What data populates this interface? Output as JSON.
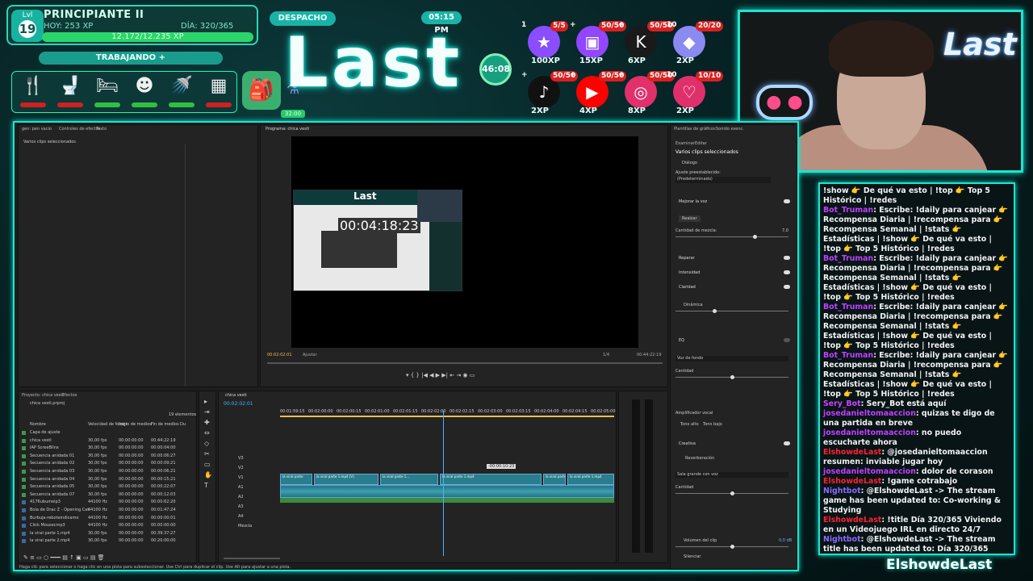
{
  "overlay": {
    "level_badge_label": "Lvl",
    "level_number": "19",
    "level_title": "PRINCIPIANTE II",
    "today_xp": "HOY: 253 XP",
    "day_counter": "DÍA: 320/365",
    "xp_progress": "12.172/12.235 XP",
    "status": "TRABAJANDO",
    "status_plus": "+",
    "dispatch": "DESPACHO",
    "clock": "05:15 PM",
    "logo": "Last",
    "timer": "46:08",
    "potion_value": "32:00",
    "needs": [
      {
        "icon": "utensils-icon",
        "glyph": "🍴",
        "level": "low"
      },
      {
        "icon": "toilet-icon",
        "glyph": "🚽",
        "level": "low"
      },
      {
        "icon": "bed-icon",
        "glyph": "🛏",
        "level": "mid"
      },
      {
        "icon": "social-icon",
        "glyph": "☻",
        "level": "mid"
      },
      {
        "icon": "shower-icon",
        "glyph": "🚿",
        "level": "mid"
      },
      {
        "icon": "fun-icon",
        "glyph": "▦",
        "level": "low"
      }
    ],
    "goals": [
      {
        "icon": "star-icon",
        "glyph": "★",
        "color": "#8a4dff",
        "count": "5/5",
        "num": "1",
        "xp": "100XP"
      },
      {
        "icon": "twitch-icon",
        "glyph": "▣",
        "color": "#9146ff",
        "count": "50/50",
        "num": "+",
        "xp": "15XP"
      },
      {
        "icon": "kick-icon",
        "glyph": "K",
        "color": "#1a1a1a",
        "count": "50/50",
        "num": "+",
        "xp": "6XP"
      },
      {
        "icon": "gem-icon",
        "glyph": "◆",
        "color": "#8a8af0",
        "count": "20/20",
        "num": "10",
        "xp": "2XP"
      },
      {
        "icon": "tiktok-icon",
        "glyph": "♪",
        "color": "#111111",
        "count": "50/50",
        "num": "+",
        "xp": "2XP"
      },
      {
        "icon": "youtube-icon",
        "glyph": "▶",
        "color": "#ff0000",
        "count": "50/50",
        "num": "+",
        "xp": "4XP"
      },
      {
        "icon": "instagram-icon",
        "glyph": "◎",
        "color": "#e1306c",
        "count": "50/50",
        "num": "+",
        "xp": "8XP"
      },
      {
        "icon": "heart-icon",
        "glyph": "♡",
        "color": "#e0306c",
        "count": "10/10",
        "num": "10",
        "xp": "2XP"
      }
    ],
    "channel_name": "ElshowdeLast",
    "webcam_logo": "Last"
  },
  "chat": [
    {
      "user": "",
      "color": "#ffffff",
      "text": "!show 👉 De qué va esto | !top 👉 Top 5 Histórico | !redes"
    },
    {
      "user": "Bot_Truman",
      "color": "#c040ff",
      "text": "Escribe: !daily para canjear 👉 Recompensa Diaria | !recompensa para 👉 Recompensa Semanal | !stats 👉 Estadísticas | !show 👉 De qué va esto | !top 👉 Top 5 Histórico | !redes"
    },
    {
      "user": "Bot_Truman",
      "color": "#c040ff",
      "text": "Escribe: !daily para canjear 👉 Recompensa Diaria | !recompensa para 👉 Recompensa Semanal | !stats 👉 Estadísticas | !show 👉 De qué va esto | !top 👉 Top 5 Histórico | !redes"
    },
    {
      "user": "Bot_Truman",
      "color": "#c040ff",
      "text": "Escribe: !daily para canjear 👉 Recompensa Diaria | !recompensa para 👉 Recompensa Semanal | !stats 👉 Estadísticas | !show 👉 De qué va esto | !top 👉 Top 5 Histórico | !redes"
    },
    {
      "user": "Bot_Truman",
      "color": "#c040ff",
      "text": "Escribe: !daily para canjear 👉 Recompensa Diaria | !recompensa para 👉 Recompensa Semanal | !stats 👉 Estadísticas | !show 👉 De qué va esto | !top 👉 Top 5 Histórico | !redes"
    },
    {
      "user": "Sery_Bot",
      "color": "#d040ff",
      "text": "Sery_Bot está aquí"
    },
    {
      "user": "josedanieltomaaccion",
      "color": "#c040ff",
      "text": "quizas te digo de una partida en breve"
    },
    {
      "user": "josedanieltomaaccion",
      "color": "#c040ff",
      "text": "no puedo escucharte ahora"
    },
    {
      "user": "ElshowdeLast",
      "color": "#ff2030",
      "text": "@josedanieltomaaccion resumen: inviable jugar hoy"
    },
    {
      "user": "josedanieltomaaccion",
      "color": "#c040ff",
      "text": "dolor de corason"
    },
    {
      "user": "ElshowdeLast",
      "color": "#ff2030",
      "text": "!game cotrabajo"
    },
    {
      "user": "Nightbot",
      "color": "#8a6aff",
      "text": "@ElshowdeLast -> The stream game has been updated to: Co-working & Studying"
    },
    {
      "user": "ElshowdeLast",
      "color": "#ff2030",
      "text": "!title Día 320/365 Viviendo en un Videojuego IRL en directo 24/7"
    },
    {
      "user": "Nightbot",
      "color": "#8a6aff",
      "text": "@ElshowdeLast -> The stream title has been updated to: Día 320/365 Viviendo en un Videojuego IRL en directo 24/7"
    }
  ],
  "premiere": {
    "source_tabs": [
      "gen: pen vacio",
      "Controles de efectos",
      "Texto"
    ],
    "source_empty": "Varios clips seleccionados",
    "program_tab": "Programa: chica vesti",
    "program_timestamp": "00:04:18:23",
    "program_tc_left": "00:02:02:01",
    "program_fit": "Ajustar",
    "program_quality": "1/4",
    "program_tc_right": "00:44:22:19",
    "project_tabs": [
      "Proyecto: chica vesti",
      "Efectos"
    ],
    "project_file": "chica vesti.prproj",
    "project_count": "19 elementos",
    "project_columns": [
      "Nombre",
      "Velocidad de fotogr.",
      "Inicio de medios",
      "Fin de medios",
      "Du"
    ],
    "project_items": [
      {
        "name": "Capa de ajuste",
        "rate": "",
        "start": "",
        "end": ""
      },
      {
        "name": "chica vesti",
        "rate": "30,00 fps",
        "start": "00:00:00:00",
        "end": "00:44:22:19"
      },
      {
        "name": "IAP ScreeBlinx",
        "rate": "30,00 fps",
        "start": "00:00:00:00",
        "end": "00:00:04:00"
      },
      {
        "name": "Secuencia anidada 01",
        "rate": "30,00 fps",
        "start": "00:00:00:00",
        "end": "00:00:06:27"
      },
      {
        "name": "Secuencia anidada 02",
        "rate": "30,00 fps",
        "start": "00:00:00:00",
        "end": "00:00:09:21"
      },
      {
        "name": "Secuencia anidada 03",
        "rate": "30,00 fps",
        "start": "00:00:00:00",
        "end": "00:00:06:21"
      },
      {
        "name": "Secuencia anidada 04",
        "rate": "30,00 fps",
        "start": "00:00:00:00",
        "end": "00:00:15:21"
      },
      {
        "name": "Secuencia anidada 05",
        "rate": "30,00 fps",
        "start": "00:00:00:00",
        "end": "00:00:22:07"
      },
      {
        "name": "Secuencia anidada 07",
        "rate": "30,00 fps",
        "start": "00:00:00:00",
        "end": "00:00:12:03"
      },
      {
        "name": "4176ubumeip3",
        "rate": "44100 Hz",
        "start": "00:00:00:00",
        "end": "00:00:62:20"
      },
      {
        "name": "Bola de Drac Z - Opening Cat",
        "rate": "44100 Hz",
        "start": "00:00:00:00",
        "end": "00:01:47:24"
      },
      {
        "name": "Burbuja-reboteindicamo",
        "rate": "44100 Hz",
        "start": "00:00:00:00",
        "end": "00:00:00:01"
      },
      {
        "name": "Click Mousecmp3",
        "rate": "44100 Hz",
        "start": "00:00:00:00",
        "end": "00:00:00:00"
      },
      {
        "name": "la viral parte 1.mp4",
        "rate": "30,00 fps",
        "start": "00:00:00:00",
        "end": "00:39:37:27"
      },
      {
        "name": "la viral parte 2.mp4",
        "rate": "30,00 fps",
        "start": "00:00:00:00",
        "end": "00:20:00:00"
      }
    ],
    "timeline_tab": "chica vesti",
    "timeline_tc": "00:02:02:01",
    "ruler": [
      "00:01:59:15",
      "00:02:00:00",
      "00:02:00:15",
      "00:02:01:00",
      "00:02:01:15",
      "00:02:02:00",
      "00:02:02:15",
      "00:02:03:00",
      "00:02:03:15",
      "00:02:04:00",
      "00:02:04:15",
      "00:02:05:00"
    ],
    "track_labels": [
      "V3",
      "V2",
      "V1",
      "A1",
      "A2",
      "A3",
      "A4",
      "Mezcla"
    ],
    "clips": [
      "la viral parte",
      "la viral parte 1.mp4 [V]",
      "la viral parte 1...",
      "la viral parte 1.mp4",
      "la viral parte 1.",
      "la viral parte 1.mp4"
    ],
    "playhead_tip": "-00:00:10:23",
    "status_bar": "Haga clic para seleccionar o haga clic en una pista para subsoleccionar. Use Ctrl para duplicar el clip. Use Alt para ajustar a una pista.",
    "right_tabs": [
      "Plantillas de gráficos",
      "Sonido esenc."
    ],
    "right_subtabs": [
      "Examinar",
      "Editar"
    ],
    "right_heading": "Varios clips seleccionados",
    "right_type": "Diálogo",
    "preset_label": "Ajuste preestablecido:",
    "preset_value": "(Predeterminado)",
    "sections": [
      {
        "label": "Mejorar la voz",
        "on": true
      },
      {
        "label": "Reparar",
        "on": true
      },
      {
        "label": "Intensidad",
        "on": true
      },
      {
        "label": "Claridad",
        "on": true
      },
      {
        "label": "EQ",
        "on": false
      },
      {
        "label": "Creativa",
        "on": true
      }
    ],
    "enhance_button": "Realzar",
    "mix_label": "Cantidad de mezcla:",
    "mix_value": "7,0",
    "dynamic_label": "Dinámica",
    "preset_voice": "Voz de fondo",
    "amplify_label": "Amplificador vocal",
    "tone_high": "Tono alto",
    "tone_low": "Tono bajo",
    "reverb_label": "Reverberación",
    "reverb_preset": "Sala grande con voz",
    "amount_label": "Cantidad",
    "clip_volume": "Volumen del clip",
    "clip_volume_val": "0,0 dB",
    "mute_label": "Silenciar"
  }
}
